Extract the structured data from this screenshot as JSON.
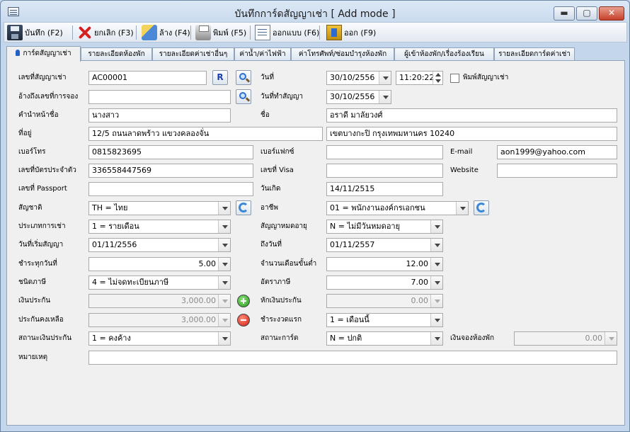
{
  "window": {
    "title": "บันทึกการ์ดสัญญาเช่า [ Add mode ]",
    "min": "▬",
    "max": "▢",
    "close": "✕"
  },
  "toolbar": {
    "save": "บันทึก (F2)",
    "cancel": "ยกเลิก (F3)",
    "clear": "ล้าง (F4)",
    "print": "พิมพ์ (F5)",
    "form": "ออกแบบ (F6)",
    "exit": "ออก (F9)"
  },
  "tabs": [
    {
      "label": "การ์ดสัญญาเช่า"
    },
    {
      "label": "รายละเอียดห้องพัก"
    },
    {
      "label": "รายละเอียดค่าเช่าอื่นๆ"
    },
    {
      "label": "ค่าน้ำ/ค่าไฟฟ้า"
    },
    {
      "label": "ค่าโทรศัพท์/ซ่อมบำรุงห้องพัก"
    },
    {
      "label": "ผู้เข้าห้องพัก/เรื่องร้องเรียน"
    },
    {
      "label": "รายละเอียดการ์ดค่าเช่า"
    }
  ],
  "form": {
    "contract_no": {
      "label": "เลขที่สัญญาเช่า",
      "value": "AC00001"
    },
    "r_button": "R",
    "date": {
      "label": "วันที่",
      "value": "30/10/2556",
      "time": "11:20:22"
    },
    "print_contract": {
      "label": "พิมพ์สัญญาเช่า"
    },
    "booking_ref": {
      "label": "อ้างถึงเลขที่การจอง",
      "value": ""
    },
    "contract_date": {
      "label": "วันที่ทำสัญญา",
      "value": "30/10/2556"
    },
    "prefix": {
      "label": "คำนำหน้าชื่อ",
      "value": "นางสาว"
    },
    "name": {
      "label": "ชื่อ",
      "value": "อราดี มาลัยวงศ์"
    },
    "address": {
      "label": "ที่อยู่",
      "value1": "12/5 ถนนลาดพร้าว แขวงคลองจั่น",
      "value2": "เขตบางกะปิ กรุงเทพมหานคร 10240"
    },
    "phone": {
      "label": "เบอร์โทร",
      "value": "0815823695"
    },
    "fax": {
      "label": "เบอร์แฟกซ์",
      "value": ""
    },
    "email": {
      "label": "E-mail",
      "value": "aon1999@yahoo.com"
    },
    "id_card": {
      "label": "เลขที่บัตรประจำตัว",
      "value": "336558447569"
    },
    "visa": {
      "label": "เลขที่ Visa",
      "value": ""
    },
    "website": {
      "label": "Website",
      "value": ""
    },
    "passport": {
      "label": "เลขที่ Passport",
      "value": ""
    },
    "birthdate": {
      "label": "วันเกิด",
      "value": "14/11/2515"
    },
    "nationality": {
      "label": "สัญชาติ",
      "value": "TH = ไทย"
    },
    "occupation": {
      "label": "อาชีพ",
      "value": "01 = พนักงานองค์กรเอกชน"
    },
    "rent_type": {
      "label": "ประเภทการเช่า",
      "value": "1 = รายเดือน"
    },
    "contract_expiry": {
      "label": "สัญญาหมดอายุ",
      "value": "N = ไม่มีวันหมดอายุ"
    },
    "start_date": {
      "label": "วันที่เริ่มสัญญา",
      "value": "01/11/2556"
    },
    "end_date": {
      "label": "ถึงวันที่",
      "value": "01/11/2557"
    },
    "pay_day": {
      "label": "ชำระทุกวันที่",
      "value": "5.00"
    },
    "min_months": {
      "label": "จำนวนเดือนขั้นต่ำ",
      "value": "12.00"
    },
    "tax_type": {
      "label": "ชนิดภาษี",
      "value": "4 = ไม่จดทะเบียนภาษี"
    },
    "tax_rate": {
      "label": "อัตราภาษี",
      "value": "7.00"
    },
    "deposit": {
      "label": "เงินประกัน",
      "value": "3,000.00"
    },
    "deposit_deduct": {
      "label": "หักเงินประกัน",
      "value": "0.00"
    },
    "deposit_remain": {
      "label": "ประกันคงเหลือ",
      "value": "3,000.00"
    },
    "first_payment": {
      "label": "ชำระงวดแรก",
      "value": "1 = เดือนนี้"
    },
    "deposit_status": {
      "label": "สถานะเงินประกัน",
      "value": "1 = คงค้าง"
    },
    "card_status": {
      "label": "สถานะการ์ด",
      "value": "N = ปกติ"
    },
    "room_booking_deposit": {
      "label": "เงินจองห้องพัก",
      "value": "0.00"
    },
    "note": {
      "label": "หมายเหตุ",
      "value": ""
    }
  }
}
